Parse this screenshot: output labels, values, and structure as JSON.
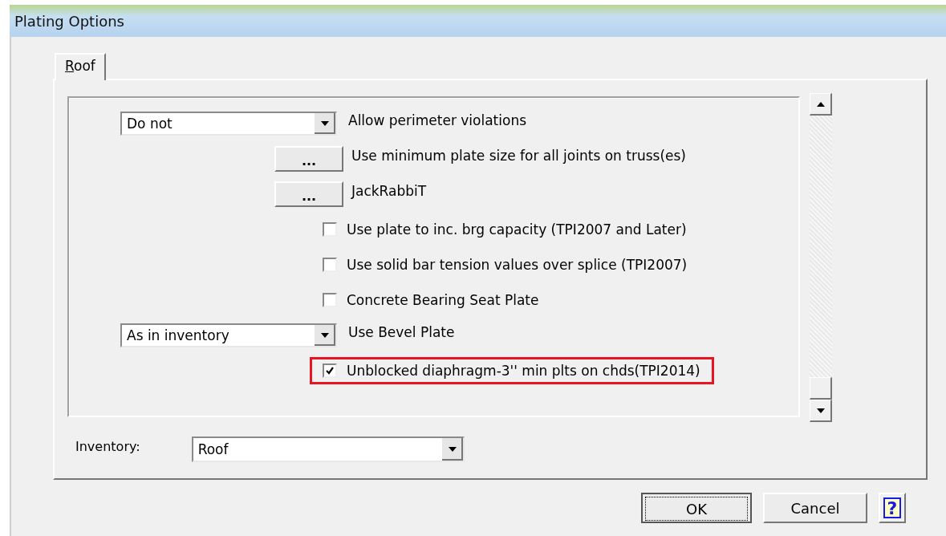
{
  "window": {
    "title": "Plating Options"
  },
  "tabs": [
    {
      "label": "Roof",
      "selected": true
    }
  ],
  "options": [
    {
      "kind": "dropdown",
      "value": "Do not",
      "label": "Allow perimeter violations",
      "highlighted": false
    },
    {
      "kind": "button",
      "button": "...",
      "label": "Use minimum plate size for all joints on truss(es)",
      "highlighted": false
    },
    {
      "kind": "button",
      "button": "...",
      "label": "JackRabbiT",
      "highlighted": false
    },
    {
      "kind": "checkbox",
      "checked": false,
      "label": "Use plate to inc. brg capacity (TPI2007 and Later)",
      "highlighted": false
    },
    {
      "kind": "checkbox",
      "checked": false,
      "label": "Use solid bar tension values over splice (TPI2007)",
      "highlighted": false
    },
    {
      "kind": "checkbox",
      "checked": false,
      "label": "Concrete Bearing Seat Plate",
      "highlighted": false
    },
    {
      "kind": "dropdown",
      "value": "As in inventory",
      "label": "Use Bevel Plate",
      "highlighted": false
    },
    {
      "kind": "checkbox",
      "checked": true,
      "label": "Unblocked diaphragm-3'' min plts on chds(TPI2014)",
      "highlighted": true
    }
  ],
  "inventory": {
    "label": "Inventory:",
    "value": "Roof"
  },
  "buttons": [
    {
      "kind": "ok",
      "label": "OK"
    },
    {
      "kind": "cancel",
      "label": "Cancel"
    },
    {
      "kind": "help",
      "label": "?"
    }
  ]
}
